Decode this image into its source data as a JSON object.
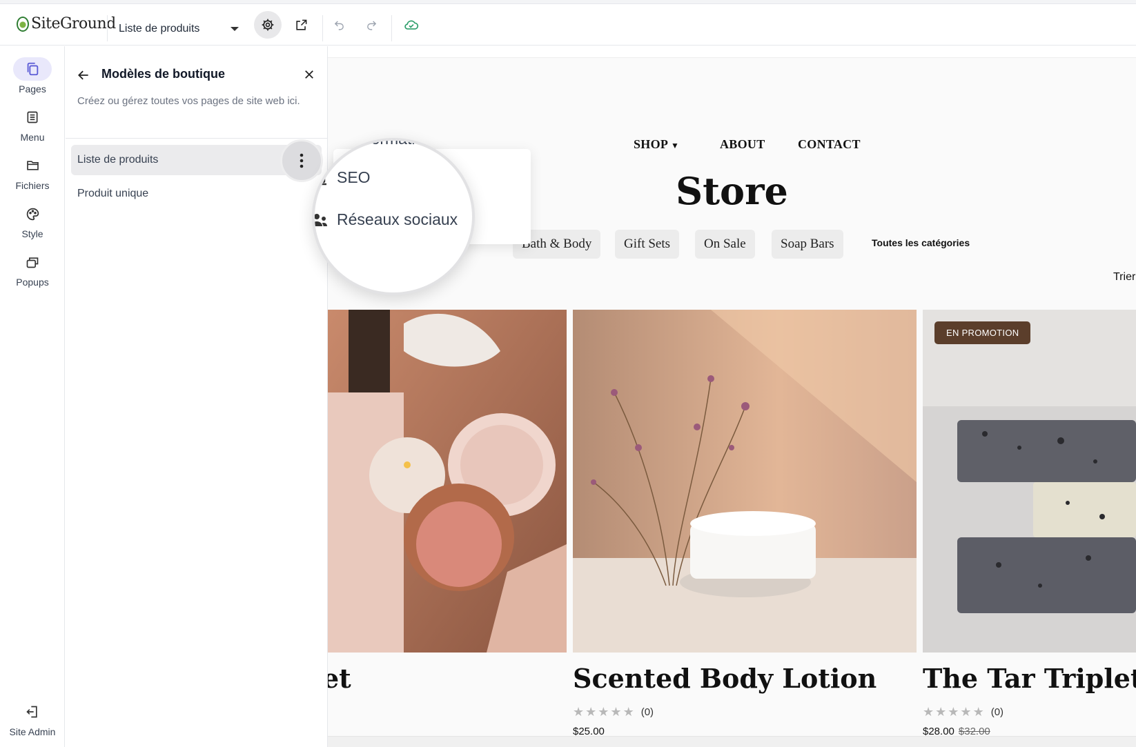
{
  "app": {
    "logo_text": "SiteGround",
    "page_selector": "Liste de produits"
  },
  "rail": {
    "items": [
      {
        "label": "Pages",
        "icon": "pages-icon"
      },
      {
        "label": "Menu",
        "icon": "menu-list-icon"
      },
      {
        "label": "Fichiers",
        "icon": "folder-icon"
      },
      {
        "label": "Style",
        "icon": "palette-icon"
      },
      {
        "label": "Popups",
        "icon": "popups-icon"
      }
    ],
    "admin_label": "Site Admin"
  },
  "panel": {
    "title": "Modèles de boutique",
    "description": "Créez ou gérez toutes vos pages de site web ici.",
    "rows": [
      "Liste de produits",
      "Produit unique"
    ]
  },
  "context_menu": {
    "partial_item": "Information",
    "items": [
      "SEO",
      "Réseaux sociaux"
    ]
  },
  "site": {
    "nav": [
      "SHOP",
      "ABOUT",
      "CONTACT"
    ],
    "title": "Store",
    "categories": [
      "Bath & Body",
      "Gift Sets",
      "On Sale",
      "Soap Bars"
    ],
    "all_categories": "Toutes les catégories",
    "sort_label": "Trier",
    "products": [
      {
        "name": "Bath & Body Gift Set",
        "visible_name": "et",
        "rating_count": "(0)",
        "price": ""
      },
      {
        "name": "Scented Body Lotion",
        "rating_count": "(0)",
        "price": "$25.00"
      },
      {
        "name": "The Tar Triplet",
        "rating_count": "(0)",
        "price": "$28.00",
        "old_price": "$32.00",
        "badge": "EN PROMOTION"
      }
    ]
  },
  "colors": {
    "accent": "#5b5bd6",
    "active_rail_bg": "#e9e8fb",
    "badge": "#5b3e2b",
    "cloud": "#2e9e6b"
  }
}
